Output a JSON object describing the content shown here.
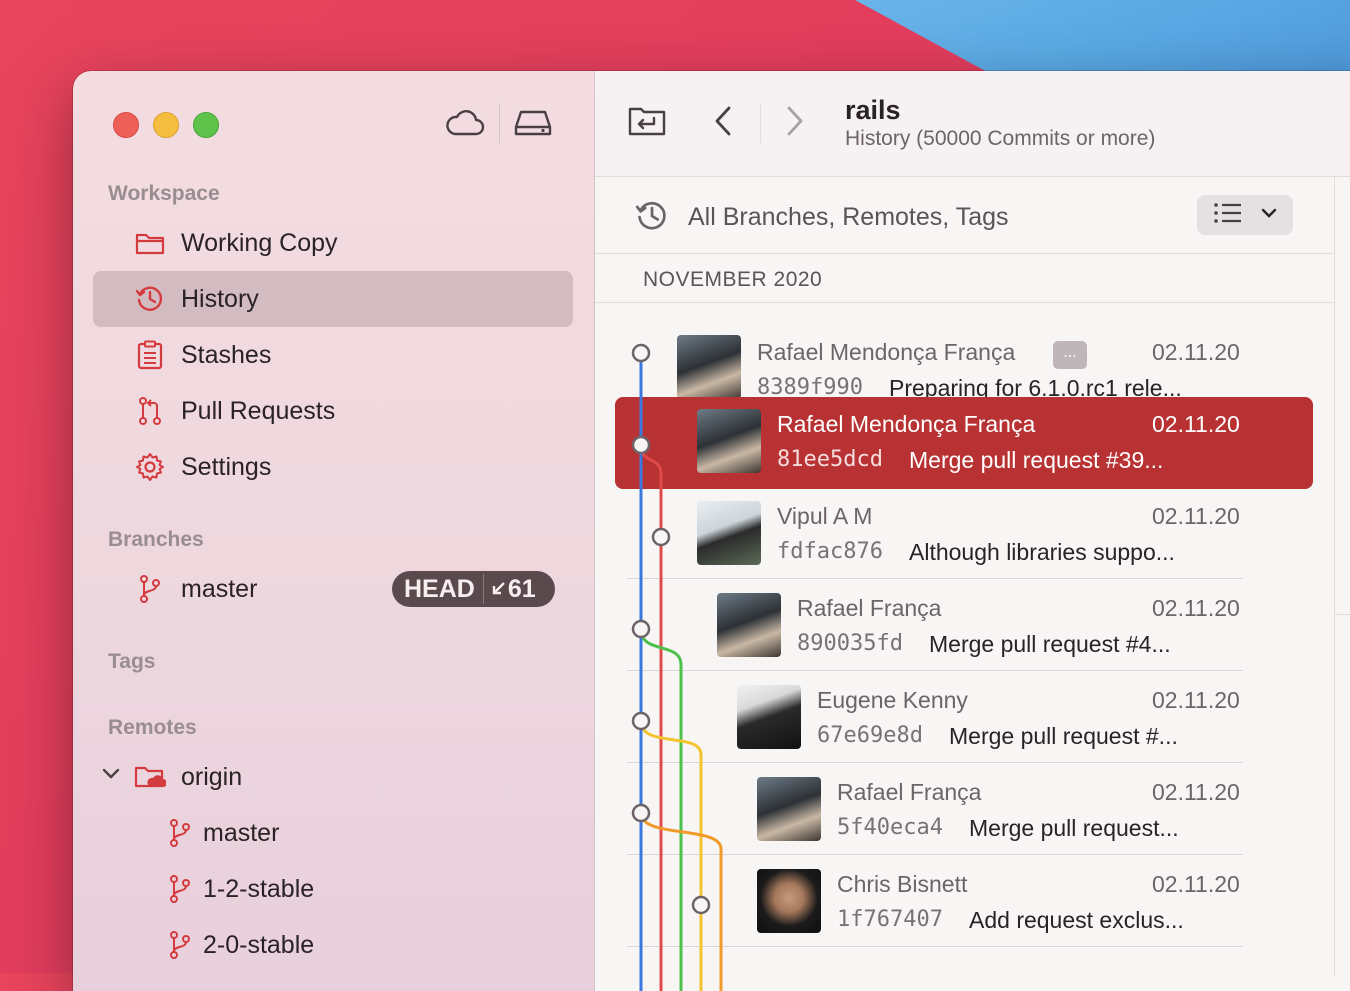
{
  "sidebar": {
    "sections": {
      "workspace": "Workspace",
      "branches": "Branches",
      "tags": "Tags",
      "remotes": "Remotes"
    },
    "workspace_items": [
      {
        "label": "Working Copy",
        "icon": "folder-icon"
      },
      {
        "label": "History",
        "icon": "history-clock-icon"
      },
      {
        "label": "Stashes",
        "icon": "clipboard-icon"
      },
      {
        "label": "Pull Requests",
        "icon": "pull-request-icon"
      },
      {
        "label": "Settings",
        "icon": "gear-icon"
      }
    ],
    "branch": {
      "label": "master",
      "head": "HEAD",
      "behind": "61"
    },
    "remote": {
      "label": "origin",
      "branches": [
        "master",
        "1-2-stable",
        "2-0-stable"
      ]
    }
  },
  "toolbar": {
    "title": "rails",
    "subtitle": "History (50000 Commits or more)"
  },
  "filter": {
    "label": "All Branches, Remotes, Tags"
  },
  "month": "NOVEMBER 2020",
  "commits": [
    {
      "author": "Rafael Mendonça França",
      "date": "02.11.20",
      "hash": "8389f990",
      "message": "Preparing for 6.1.0.rc1 rele...",
      "more": "..."
    },
    {
      "author": "Rafael Mendonça França",
      "date": "02.11.20",
      "hash": "81ee5dcd",
      "message": "Merge pull request #39..."
    },
    {
      "author": "Vipul A M",
      "date": "02.11.20",
      "hash": "fdfac876",
      "message": "Although libraries suppo..."
    },
    {
      "author": "Rafael França",
      "date": "02.11.20",
      "hash": "890035fd",
      "message": "Merge pull request #4..."
    },
    {
      "author": "Eugene Kenny",
      "date": "02.11.20",
      "hash": "67e69e8d",
      "message": "Merge pull request #..."
    },
    {
      "author": "Rafael França",
      "date": "02.11.20",
      "hash": "5f40eca4",
      "message": "Merge pull request..."
    },
    {
      "author": "Chris Bisnett",
      "date": "02.11.20",
      "hash": "1f767407",
      "message": "Add request exclus..."
    }
  ],
  "colors": {
    "accent": "#b83234",
    "graph_blue": "#3a78e0",
    "graph_red": "#e14a4a",
    "graph_green": "#4cc04a",
    "graph_yellow": "#f4c430",
    "graph_orange": "#f09a2a"
  }
}
